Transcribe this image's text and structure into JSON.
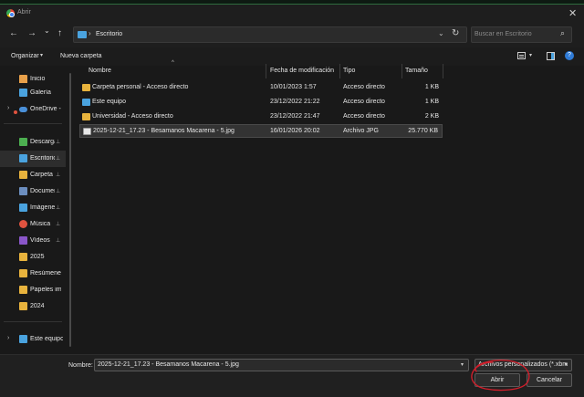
{
  "window": {
    "title": "Abrir",
    "close_glyph": "✕"
  },
  "nav": {
    "back_glyph": "←",
    "forward_glyph": "→",
    "dropdown_glyph": "⌄",
    "up_glyph": "↑",
    "address": "Escritorio",
    "address_sep": "›",
    "address_drop": "⌄",
    "refresh_glyph": "↻",
    "search_placeholder": "Buscar en Escritorio",
    "search_glyph": "⌕"
  },
  "toolbar": {
    "organize": "Organizar",
    "chev": "▾",
    "new_folder": "Nueva carpeta",
    "help": "?"
  },
  "sidebar": {
    "items": [
      {
        "label": "Inicio",
        "icon": "home-icon",
        "color": "#e8a04a"
      },
      {
        "label": "Galería",
        "icon": "gallery-icon",
        "color": "#4aa3df"
      },
      {
        "label": "OneDrive - I",
        "icon": "onedrive-icon",
        "color": "#4a90d9"
      },
      {
        "label": "Descargas",
        "icon": "download-icon",
        "color": "#4caf50"
      },
      {
        "label": "Escritorio",
        "icon": "desktop-icon",
        "color": "#4aa3df"
      },
      {
        "label": "Carpeta pe",
        "icon": "folder-icon",
        "color": "#e8b33d"
      },
      {
        "label": "Documentos",
        "icon": "documents-icon",
        "color": "#6c8ebf"
      },
      {
        "label": "Imágenes",
        "icon": "pictures-icon",
        "color": "#4aa3df"
      },
      {
        "label": "Música",
        "icon": "music-icon",
        "color": "#e0533f"
      },
      {
        "label": "Vídeos",
        "icon": "videos-icon",
        "color": "#8a56c9"
      },
      {
        "label": "2025",
        "icon": "folder-icon",
        "color": "#e8b33d"
      },
      {
        "label": "Resúmenes",
        "icon": "folder-icon",
        "color": "#e8b33d"
      },
      {
        "label": "Papeles imp",
        "icon": "folder-icon",
        "color": "#e8b33d"
      },
      {
        "label": "2024",
        "icon": "folder-icon",
        "color": "#e8b33d"
      },
      {
        "label": "Este equipo",
        "icon": "this-pc-icon",
        "color": "#4aa3df"
      }
    ],
    "pin_glyph": "📌",
    "expand_glyph": "›"
  },
  "columns": {
    "name": "Nombre",
    "modified": "Fecha de modificación",
    "type": "Tipo",
    "size": "Tamaño",
    "sort_glyph": "^"
  },
  "files": [
    {
      "name": "Carpeta personal - Acceso directo",
      "modified": "10/01/2023 1:57",
      "type": "Acceso directo",
      "size": "1 KB",
      "icon": "folder-icon"
    },
    {
      "name": "Este equipo",
      "modified": "23/12/2022 21:22",
      "type": "Acceso directo",
      "size": "1 KB",
      "icon": "this-pc-icon"
    },
    {
      "name": "Universidad - Acceso directo",
      "modified": "23/12/2022 21:47",
      "type": "Acceso directo",
      "size": "2 KB",
      "icon": "folder-icon"
    },
    {
      "name": "2025-12-21_17.23 - Besamanos Macarena - 5.jpg",
      "modified": "16/01/2026 20:02",
      "type": "Archivo JPG",
      "size": "25.770 KB",
      "icon": "image-icon"
    }
  ],
  "footer": {
    "name_label": "Nombre:",
    "file_name": "2025-12-21_17.23 - Besamanos Macarena - 5.jpg",
    "file_type": "Archivos personalizados (*.xbm",
    "open": "Abrir",
    "cancel": "Cancelar"
  },
  "colors": {
    "accent": "#2f7bd6",
    "annotation": "#d21e2b",
    "folder": "#e8b33d"
  }
}
